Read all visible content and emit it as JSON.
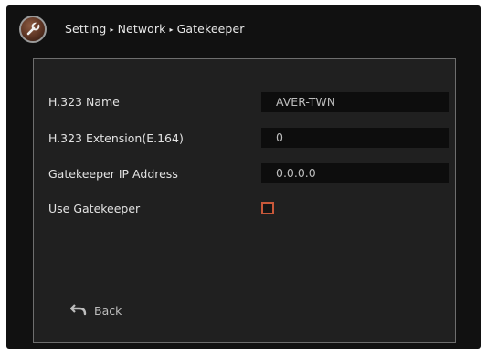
{
  "breadcrumb": {
    "items": [
      "Setting",
      "Network",
      "Gatekeeper"
    ],
    "separator": "▸"
  },
  "icons": {
    "logo": "wrench-icon",
    "back": "undo-arrow-icon"
  },
  "form": {
    "h323_name": {
      "label": "H.323 Name",
      "value": "AVER-TWN"
    },
    "h323_extension": {
      "label": "H.323 Extension(E.164)",
      "value": "0"
    },
    "gatekeeper_ip": {
      "label": "Gatekeeper IP Address",
      "value": "0.0.0.0"
    },
    "use_gatekeeper": {
      "label": "Use Gatekeeper",
      "checked": false
    }
  },
  "back_label": "Back",
  "colors": {
    "accent": "#c8583a",
    "background": "#111111",
    "panel": "#202020"
  }
}
